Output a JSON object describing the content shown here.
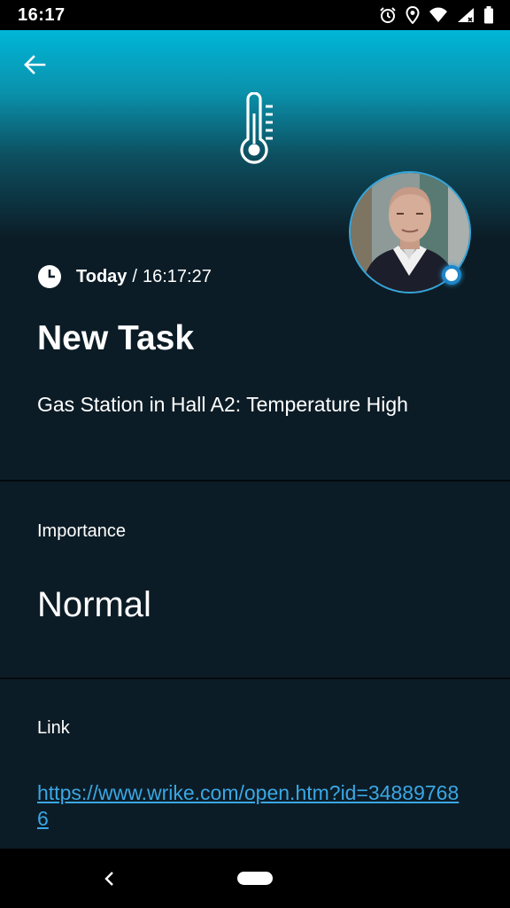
{
  "status_bar": {
    "time": "16:17",
    "icons": [
      "alarm-icon",
      "location-icon",
      "wifi-icon",
      "signal-icon",
      "battery-icon"
    ]
  },
  "header": {
    "back_icon": "arrow-left-icon",
    "category_icon": "thermometer-icon",
    "accent_color": "#00b6d8",
    "avatar_border_color": "#35a7dc",
    "presence_dot_color": "#1e86c8"
  },
  "task": {
    "date_label": "Today",
    "date_separator": "/",
    "time": "16:17:27",
    "title": "New Task",
    "description": "Gas Station in Hall A2: Temperature High"
  },
  "importance": {
    "label": "Importance",
    "value": "Normal"
  },
  "link": {
    "label": "Link",
    "value": "https://www.wrike.com/open.htm?id=348897686",
    "color": "#3aa7e4"
  },
  "nav_bar": {
    "icons": [
      "nav-back-icon",
      "home-pill-icon"
    ]
  }
}
